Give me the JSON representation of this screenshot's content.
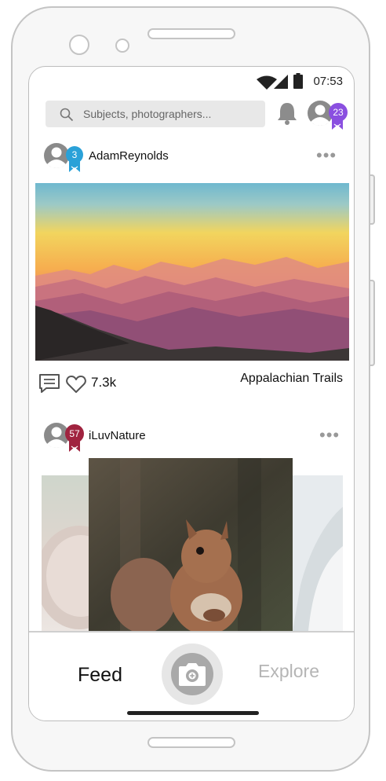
{
  "status_bar": {
    "time": "07:53"
  },
  "search": {
    "placeholder": "Subjects, photographers..."
  },
  "header": {
    "user_badge": "23"
  },
  "posts": [
    {
      "username": "AdamReynolds",
      "badge": "3",
      "comment_icon": "comment-icon",
      "likes": "7.3k",
      "location": "Appalachian Trails"
    },
    {
      "username": "iLuvNature",
      "badge": "57"
    }
  ],
  "bottom_nav": {
    "feed_label": "Feed",
    "explore_label": "Explore"
  },
  "colors": {
    "badge_blue": "#2aa1d8",
    "badge_purple": "#8a4fe0",
    "badge_maroon": "#a0233f",
    "explore_gray": "#b5b5b5"
  }
}
